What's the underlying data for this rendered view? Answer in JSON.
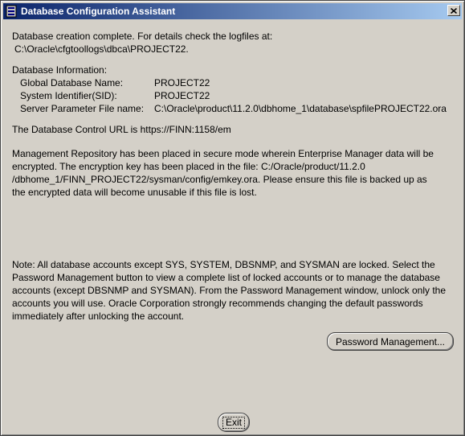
{
  "window": {
    "title": "Database Configuration Assistant"
  },
  "completion": {
    "line1": "Database creation complete. For details check the logfiles at:",
    "line2": "C:\\Oracle\\cfgtoollogs\\dbca\\PROJECT22."
  },
  "db_info": {
    "heading": "Database Information:",
    "rows": [
      {
        "label": "Global Database Name:",
        "value": "PROJECT22"
      },
      {
        "label": "System Identifier(SID):",
        "value": "PROJECT22"
      },
      {
        "label": "Server Parameter File name:",
        "value": "C:\\Oracle\\product\\11.2.0\\dbhome_1\\database\\spfilePROJECT22.ora"
      }
    ]
  },
  "control_url": "The Database Control URL is https://FINN:1158/em",
  "repository": {
    "lines": [
      "Management Repository has been placed in secure mode wherein Enterprise Manager data will be",
      "encrypted.  The encryption key has been placed in the file: C:/Oracle/product/11.2.0",
      "/dbhome_1/FINN_PROJECT22/sysman/config/emkey.ora.   Please ensure this file is backed up as",
      "the encrypted data will become unusable if this file is lost."
    ]
  },
  "note": {
    "lines": [
      "Note: All database accounts except SYS, SYSTEM, DBSNMP, and SYSMAN are locked. Select the",
      "Password Management button to view a complete list of locked accounts or to manage the database",
      "accounts (except DBSNMP and SYSMAN). From the Password Management window, unlock only the",
      "accounts you will use. Oracle Corporation strongly recommends changing the default passwords",
      "immediately after unlocking the account."
    ]
  },
  "buttons": {
    "password_management": "Password Management...",
    "exit": "Exit"
  },
  "icons": {
    "title": "application-icon",
    "close": "close-icon"
  },
  "colors": {
    "titlebar_start": "#0a246a",
    "titlebar_end": "#a6caf0",
    "window_bg": "#d4d0c8"
  }
}
